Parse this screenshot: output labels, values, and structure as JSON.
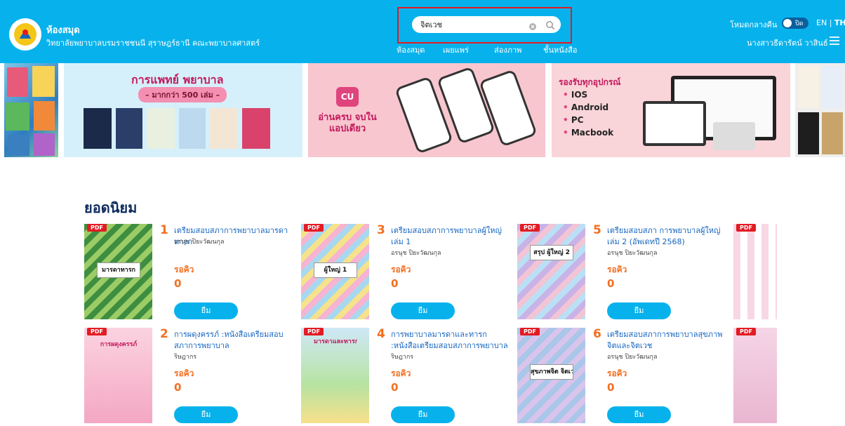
{
  "header": {
    "brand_title": "ห้องสมุด",
    "brand_subtitle": "วิทยาลัยพยาบาลบรมราชชนนี สุราษฎร์ธานี คณะพยาบาลศาสตร์",
    "search": {
      "value": "จิตเวช",
      "placeholder": ""
    },
    "nav": [
      "ห้องสมุด",
      "เผยแพร่",
      "ส่องภาพ",
      "ชั้นหนังสือ"
    ],
    "night_mode_label": "โหมดกลางคืน",
    "toggle_label": "ปิด",
    "lang_en": "EN",
    "lang_sep": "|",
    "lang_th": "TH",
    "user_name": "นางสาวธีดารัตน์ วาสินธ์"
  },
  "banners": {
    "medical": {
      "title": "การแพทย์ พยาบาล",
      "subtitle": "– มากกว่า 500 เล่ม –"
    },
    "app": {
      "logo": "CU",
      "text": "อ่านครบ จบในแอปเดียว"
    },
    "devices": {
      "title": "รองรับทุกอุปกรณ์",
      "items": [
        "IOS",
        "Android",
        "PC",
        "Macbook"
      ]
    }
  },
  "section_title": "ยอดนิยม",
  "books": [
    {
      "rank": "1",
      "title": "เตรียมสอบสภาการพยาบาลมารดาทารก",
      "author": "อรนุช ปิยะวัฒนกุล",
      "queue_label": "รอคิว",
      "queue": "0",
      "borrow": "ยืม",
      "pdf": "PDF",
      "cover_text": "มารดาทารก"
    },
    {
      "rank": "3",
      "title": "เตรียมสอบสภาการพยาบาลผู้ใหญ่ เล่ม 1",
      "author": "อรนุช ปิยะวัฒนกุล",
      "queue_label": "รอคิว",
      "queue": "0",
      "borrow": "ยืม",
      "pdf": "PDF",
      "cover_text": "ผู้ใหญ่ 1"
    },
    {
      "rank": "5",
      "title": "เตรียมสอบสภา การพยาบาลผู้ใหญ่ เล่ม 2 (อัพเดทปี 2568)",
      "author": "อรนุช ปิยะวัฒนกุล",
      "queue_label": "รอคิว",
      "queue": "0",
      "borrow": "ยืม",
      "pdf": "PDF",
      "cover_text": "สรุป ผู้ใหญ่ 2"
    },
    {
      "rank": "2",
      "title": "การผดุงครรภ์ :หนังสือเตรียมสอบสภาการพยาบาล",
      "author": "ริษฎากร",
      "queue_label": "รอคิว",
      "queue": "0",
      "borrow": "ยืม",
      "pdf": "PDF",
      "cover_text": "การผดุงครรภ์"
    },
    {
      "rank": "4",
      "title": "การพยาบาลมารดาและทารก :หนังสือเตรียมสอบสภาการพยาบาล",
      "author": "ริษฎากร",
      "queue_label": "รอคิว",
      "queue": "0",
      "borrow": "ยืม",
      "pdf": "PDF",
      "cover_text": "มารดาและทารก"
    },
    {
      "rank": "6",
      "title": "เตรียมสอบสภาการพยาบาลสุขภาพจิตและจิตเวช",
      "author": "อรนุช ปิยะวัฒนกุล",
      "queue_label": "รอคิว",
      "queue": "0",
      "borrow": "ยืม",
      "pdf": "PDF",
      "cover_text": "สุขภาพจิต จิตเวช"
    }
  ],
  "colors": {
    "header": "#07b2ec",
    "accent": "#f36f21",
    "link": "#1565c0",
    "pdf_badge": "#e31b23",
    "highlight": "#e31b23"
  }
}
